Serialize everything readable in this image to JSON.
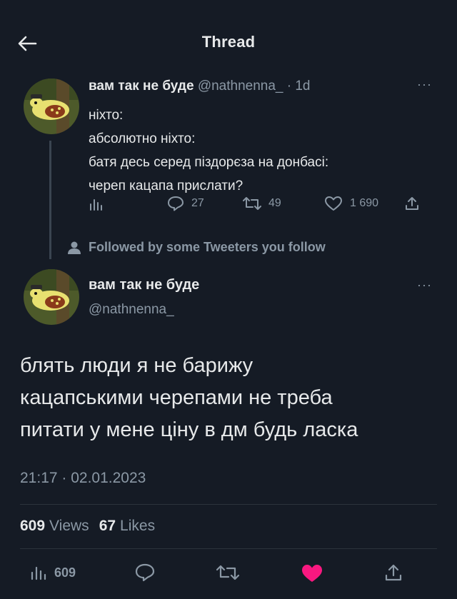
{
  "header": {
    "title": "Thread"
  },
  "tweet1": {
    "name": "вам так не буде",
    "handle_time": "@nathnenna_ · 1d",
    "lines": [
      "ніхто:",
      "абсолютно ніхто:",
      "батя десь серед піздорєза на донбасі:",
      "череп кацапа прислати?"
    ],
    "replies": "27",
    "retweets": "49",
    "likes": "1 690"
  },
  "followed_note": "Followed by some Tweeters you follow",
  "tweet2": {
    "name": "вам так не буде",
    "handle": "@nathnenna_",
    "lines": [
      "блять люди я не барижу",
      "кацапськими черепами не треба",
      "питати у мене ціну в дм будь ласка"
    ],
    "timestamp": "21:17 · 02.01.2023",
    "views_count": "609",
    "views_label": "Views",
    "likes_count": "67",
    "likes_label": "Likes",
    "bottom_views": "609",
    "liked": true,
    "like_color": "#f91880"
  }
}
